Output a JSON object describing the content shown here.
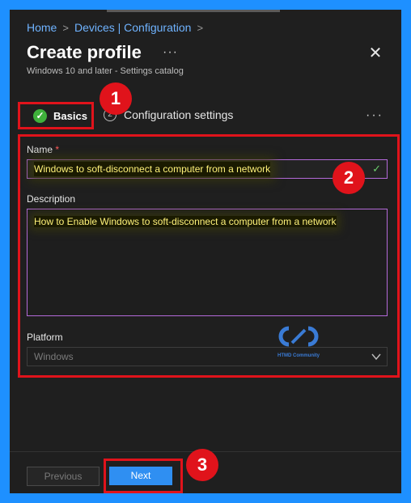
{
  "breadcrumb": {
    "home": "Home",
    "sep": ">",
    "devices": "Devices | Configuration"
  },
  "header": {
    "title": "Create profile",
    "more": "···",
    "close": "✕",
    "subtitle": "Windows 10 and later - Settings catalog"
  },
  "steps": [
    {
      "label": "Basics",
      "status": "complete",
      "icon": "✓"
    },
    {
      "label": "Configuration settings",
      "number": "2"
    }
  ],
  "tabs_more": "···",
  "callouts": [
    "1",
    "2",
    "3"
  ],
  "form": {
    "name_label": "Name",
    "required_mark": "*",
    "name_value": "Windows to soft-disconnect a computer from a network",
    "name_valid_icon": "✓",
    "description_label": "Description",
    "description_value": "How to Enable Windows to soft-disconnect a computer from a network",
    "platform_label": "Platform",
    "platform_value": "Windows"
  },
  "watermark": {
    "text": "HTMD Community"
  },
  "footer": {
    "previous_label": "Previous",
    "next_label": "Next"
  },
  "colors": {
    "accent": "#2f8ff2",
    "callout_red": "#e0131b",
    "success": "#3fb13b",
    "frame_blue": "#1e90ff"
  },
  "icons": {
    "close": "close-icon",
    "check": "check-circle-icon",
    "chevron": "chevron-down-icon",
    "more": "more-icon"
  }
}
